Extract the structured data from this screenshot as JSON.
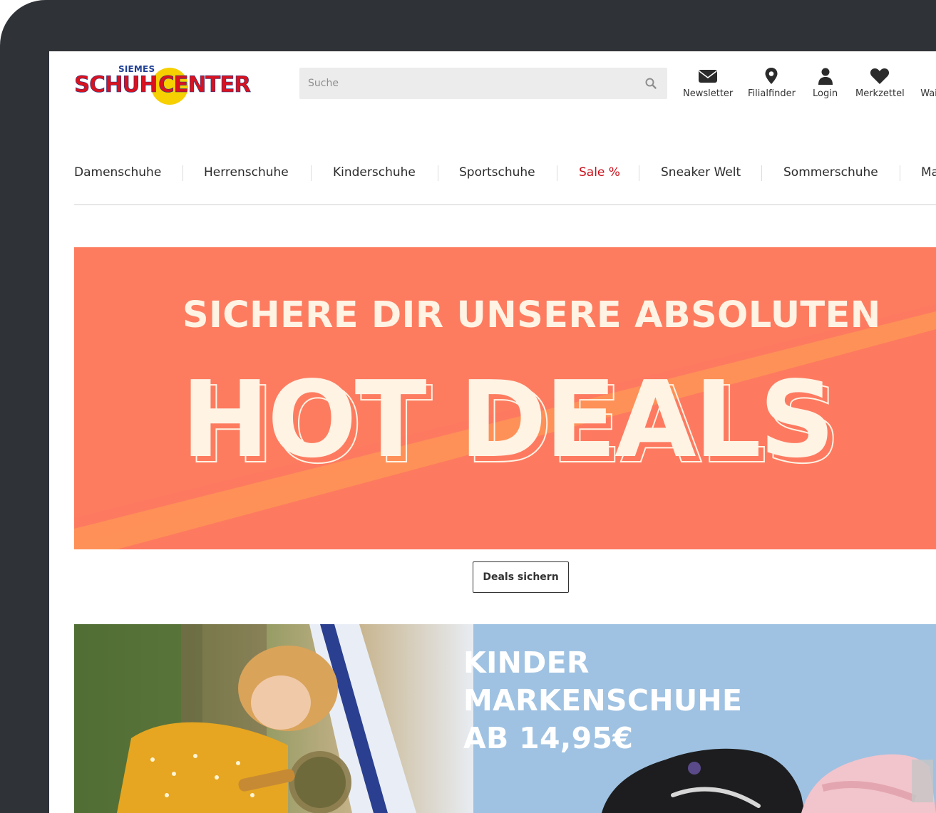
{
  "brand": {
    "small": "SIEMES",
    "word_left": "SCHUH",
    "word_right": "CENTER"
  },
  "search": {
    "placeholder": "Suche"
  },
  "header_links": [
    {
      "label": "Newsletter",
      "icon": "envelope-icon"
    },
    {
      "label": "Filialfinder",
      "icon": "map-pin-icon"
    },
    {
      "label": "Login",
      "icon": "user-icon"
    },
    {
      "label": "Merkzettel",
      "icon": "heart-icon"
    },
    {
      "label": "Wai",
      "icon": "cart-icon"
    }
  ],
  "nav": [
    {
      "label": "Damenschuhe"
    },
    {
      "label": "Herrenschuhe"
    },
    {
      "label": "Kinderschuhe"
    },
    {
      "label": "Sportschuhe"
    },
    {
      "label": "Sale %"
    },
    {
      "label": "Sneaker Welt"
    },
    {
      "label": "Sommerschuhe"
    },
    {
      "label": "Ma"
    }
  ],
  "hero": {
    "subtitle": "SICHERE DIR UNSERE ABSOLUTEN",
    "title": "HOT DEALS",
    "button": "Deals sichern"
  },
  "kids_banner": {
    "line1": "KINDER",
    "line2": "MARKENSCHUHE",
    "line3": "AB 14,95€"
  },
  "colors": {
    "frame": "#2f3237",
    "hero_bg": "#fd7a61",
    "hero_accent": "#ff8c55",
    "sale_red": "#c9101a",
    "kids_bg": "#9fc2e2",
    "logo_red": "#d8121f",
    "logo_blue": "#1b3a8f",
    "logo_yellow": "#f6d000"
  }
}
